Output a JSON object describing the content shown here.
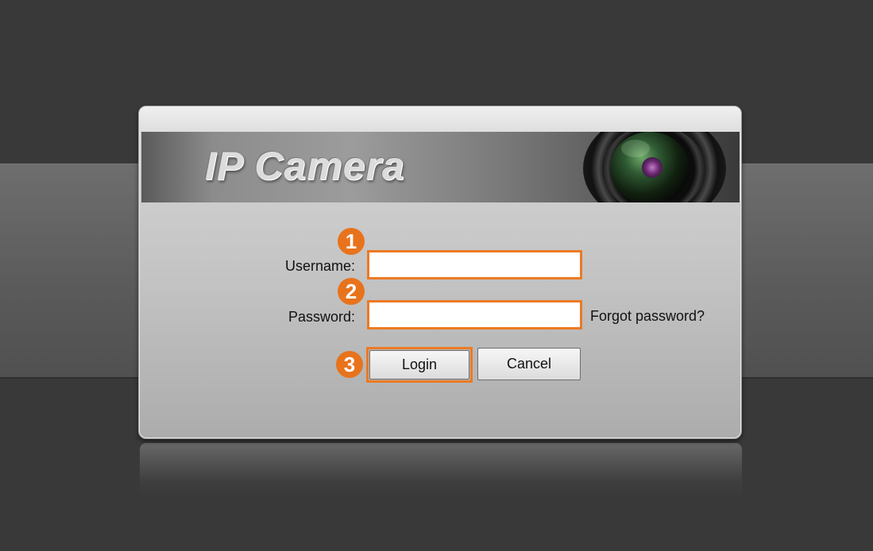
{
  "app": {
    "title": "IP Camera"
  },
  "form": {
    "username_label": "Username:",
    "username_value": "",
    "password_label": "Password:",
    "password_value": "",
    "forgot_link": "Forgot password?",
    "login_label": "Login",
    "cancel_label": "Cancel"
  },
  "annotations": {
    "step1": "1",
    "step2": "2",
    "step3": "3",
    "highlight_color": "#ec7a23",
    "badge_color": "#e8731c"
  }
}
